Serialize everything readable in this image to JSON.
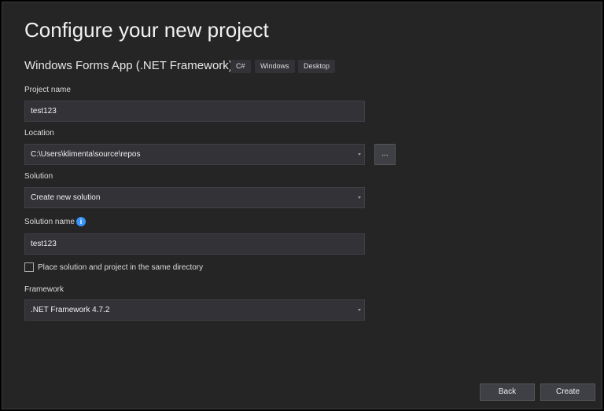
{
  "title": "Configure your new project",
  "template": {
    "name": "Windows Forms App (.NET Framework)",
    "tags": [
      "C#",
      "Windows",
      "Desktop"
    ]
  },
  "project_name": {
    "label": "Project name",
    "value": "test123"
  },
  "location": {
    "label": "Location",
    "value": "C:\\Users\\klimenta\\source\\repos",
    "browse": "..."
  },
  "solution": {
    "label": "Solution",
    "value": "Create new solution"
  },
  "solution_name": {
    "label": "Solution name",
    "info": "i",
    "value": "test123"
  },
  "same_dir": {
    "label": "Place solution and project in the same directory",
    "checked": false
  },
  "framework": {
    "label": "Framework",
    "value": ".NET Framework 4.7.2"
  },
  "buttons": {
    "back": "Back",
    "create": "Create"
  }
}
